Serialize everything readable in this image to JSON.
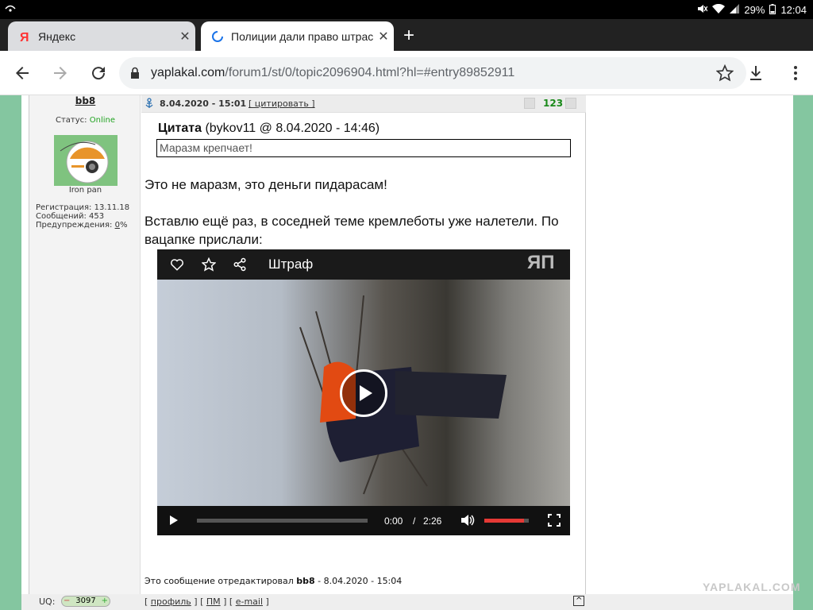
{
  "status_bar": {
    "battery": "29%",
    "time": "12:04"
  },
  "tabs": [
    {
      "title": "Яндекс",
      "favicon": "yandex-icon"
    },
    {
      "title": "Полиции дали право штрас",
      "favicon": "loading-icon"
    }
  ],
  "toolbar": {
    "url_domain": "yaplakal.com",
    "url_path": "/forum1/st/0/topic2096904.html?hl=#entry89852911"
  },
  "post": {
    "author": "bb8",
    "status_label": "Статус:",
    "status_value": "Online",
    "avatar_caption": "Iron pan",
    "registration": "Регистрация: 13.11.18",
    "messages": "Сообщений: 453",
    "warnings_label": "Предупреждения: ",
    "warnings_value": "0",
    "warnings_suffix": "%",
    "date": "8.04.2020 - 15:01",
    "quote_link": "[ цитировать ]",
    "rating": "123",
    "quote_title": "Цитата",
    "quote_meta": "(bykov11 @ 8.04.2020 - 14:46)",
    "quote_text": "Маразм крепчает!",
    "text1": "Это не маразм, это деньги пидарасам!",
    "text2": "Вставлю ещё раз, в соседней теме кремлеботы уже налетели. По вацапке прислали:",
    "edited_prefix": "Это сообщение отредактировал",
    "edited_user": "bb8",
    "edited_date": " - 8.04.2020 - 15:04"
  },
  "video": {
    "title": "Штраф",
    "logo": "ЯП",
    "current_time": "0:00",
    "separator": "/",
    "duration": "2:26",
    "progress": 0.0,
    "volume": 0.9
  },
  "footer": {
    "uq_label": "UQ:",
    "uq_value": "3097",
    "profile": "профиль",
    "pm": "ПМ",
    "email": "e-mail",
    "up": "^"
  },
  "watermark": "YAPLAKAL.COM",
  "colors": {
    "online": "#21a321",
    "rating": "#1b8a1b",
    "accent": "#84c6a0",
    "volume": "#e53935"
  }
}
